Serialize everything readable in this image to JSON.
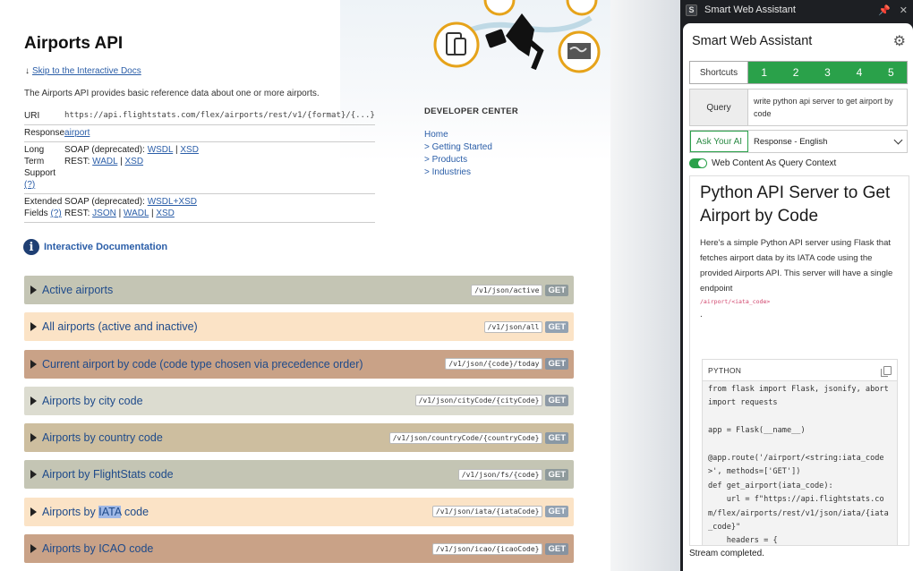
{
  "page": {
    "title": "Airports API",
    "skip_link": "Skip to the Interactive Docs",
    "intro": "The Airports API provides basic reference data about one or more airports.",
    "meta": {
      "uri_label": "URI",
      "uri_value": "https://api.flightstats.com/flex/airports/rest/v1/{format}/{...}",
      "response_label": "Response",
      "response_link": "airport",
      "long_term_label_1": "Long Term",
      "long_term_label_2": "Support",
      "long_term_help": "(?)",
      "soap_deprecated": "SOAP (deprecated):",
      "rest_label": "REST:",
      "lt_soap_links": [
        "WSDL",
        "XSD"
      ],
      "lt_rest_links": [
        "WADL",
        "XSD"
      ],
      "extended_label_1": "Extended",
      "extended_label_2": "Fields",
      "extended_help": "(?)",
      "ext_soap_links": [
        "WSDL+XSD"
      ],
      "ext_rest_links": [
        "JSON",
        "WADL",
        "XSD"
      ],
      "separator": "|"
    },
    "developer_center": {
      "title": "DEVELOPER CENTER",
      "links": [
        "Home",
        "> Getting Started",
        "> Products",
        "> Industries"
      ]
    },
    "interactive_docs": "Interactive Documentation",
    "endpoints": [
      {
        "label": "Active airports",
        "path": "/v1/json/active",
        "method": "GET",
        "color": "#c4c5b4"
      },
      {
        "label": "All airports (active and inactive)",
        "path": "/v1/json/all",
        "method": "GET",
        "color": "#fbe3c6"
      },
      {
        "label": "Current airport by code (code type chosen via precedence order)",
        "path": "/v1/json/{code}/today",
        "method": "GET",
        "color": "#c9a287"
      },
      {
        "label": "Airports by city code",
        "path": "/v1/json/cityCode/{cityCode}",
        "method": "GET",
        "color": "#dcdcd0"
      },
      {
        "label": "Airports by country code",
        "path": "/v1/json/countryCode/{countryCode}",
        "method": "GET",
        "color": "#cdbe9f"
      },
      {
        "label": "Airport by FlightStats code",
        "path": "/v1/json/fs/{code}",
        "method": "GET",
        "color": "#c4c5b4"
      },
      {
        "label_before": "Airports by ",
        "label_highlight": "IATA",
        "label_after": " code",
        "path": "/v1/json/iata/{iataCode}",
        "method": "GET",
        "color": "#fbe3c6"
      },
      {
        "label": "Airports by ICAO code",
        "path": "/v1/json/icao/{icaoCode}",
        "method": "GET",
        "color": "#c9a287"
      }
    ]
  },
  "assistant": {
    "window_title": "Smart Web Assistant",
    "window_badge": "S",
    "header": "Smart Web Assistant",
    "shortcuts_label": "Shortcuts",
    "shortcut_numbers": [
      "1",
      "2",
      "3",
      "4",
      "5"
    ],
    "query_label": "Query",
    "query_text": "write python api server to get airport by code",
    "ask_button": "Ask Your AI",
    "response_mode": "Response - English",
    "toggle_label": "Web Content As Query Context",
    "toggle_on": true,
    "answer_title": "Python API Server to Get Airport by Code",
    "answer_text": "Here's a simple Python API server using Flask that fetches airport data by its IATA code using the provided Airports API. This server will have a single endpoint",
    "answer_endpoint": "/airport/<iata_code>",
    "answer_after": ".",
    "code_lang": "PYTHON",
    "code": "from flask import Flask, jsonify, abort\nimport requests\n\napp = Flask(__name__)\n\n@app.route('/airport/<string:iata_code>', methods=['GET'])\ndef get_airport(iata_code):\n    url = f\"https://api.flightstats.com/flex/airports/rest/v1/json/iata/{iata_code}\"\n    headers = {\n        \"Authorization\": \"Bearer",
    "status": "Stream completed.",
    "colors": {
      "accent": "#2aa14a",
      "endpoint_text": "#d0436b"
    }
  }
}
